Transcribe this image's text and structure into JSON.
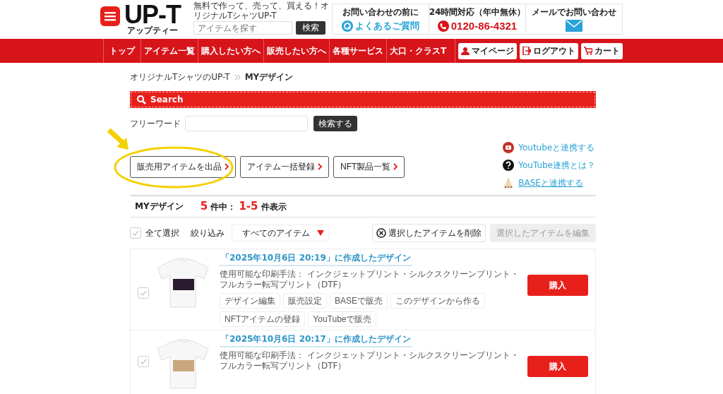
{
  "header": {
    "logo": "UP-T",
    "logo_reading": "アップティー",
    "tagline": "無料で作って、売って、買える！オリジナルTシャツUP-T",
    "search": {
      "placeholder": "アイテムを探す",
      "button": "検索"
    },
    "contacts": [
      {
        "kind": "faq",
        "caption": "お問い合わせの前に",
        "label": "よくあるご質問"
      },
      {
        "kind": "phone",
        "caption": "24時間対応（年中無休）",
        "label": "0120-86-4321"
      },
      {
        "kind": "mail",
        "caption": "メールでお問い合わせ"
      }
    ]
  },
  "nav": {
    "items": [
      "トップ",
      "アイテム一覧",
      "購入したい方へ",
      "販売したい方へ",
      "各種サービス",
      "大口・クラスT"
    ],
    "buttons": [
      {
        "kind": "user",
        "label": "マイページ"
      },
      {
        "kind": "logout",
        "label": "ログアウト"
      },
      {
        "kind": "cart",
        "label": "カート"
      }
    ]
  },
  "breadcrumb": [
    {
      "label": "オリジナルTシャツのUP-T",
      "current": false
    },
    {
      "label": "MYデザイン",
      "current": true
    }
  ],
  "search_panel": {
    "title": "Search",
    "label": "フリーワード",
    "button": "検索する"
  },
  "actions": [
    "販売用アイテムを出品",
    "アイテム一括登録",
    "NFT製品一覧"
  ],
  "side_links": [
    {
      "kind": "youtube",
      "label": "Youtubeと連携する",
      "underlined": false
    },
    {
      "kind": "help",
      "label": "YouTube連携とは？",
      "underlined": false
    },
    {
      "kind": "base",
      "label": "BASEと連携する",
      "underlined": true
    }
  ],
  "list_header": {
    "title": "MYデザイン",
    "count": "5",
    "count_suffix": "件中：",
    "range": "1-5",
    "range_suffix": "件表示"
  },
  "toolbar": {
    "select_all": {
      "label": "全て選択",
      "checked": false
    },
    "filter_label": "絞り込み",
    "filter_value": "すべてのアイテム",
    "delete": "選択したアイテムを削除",
    "edit": {
      "label": "選択したアイテムを編集",
      "disabled": true
    }
  },
  "designs": [
    {
      "checked": false,
      "title": "「2025年10月6日 20:19」に作成したデザイン",
      "methods": "使用可能な印刷手法： インクジェットプリント・シルクスクリーンプリント・フルカラー転写プリント（DTF）",
      "buy": "購入",
      "buttons": [
        "デザイン編集",
        "販売設定",
        "BASEで販売",
        "このデザインから作る",
        "NFTアイテムの登録",
        "YouTubeで販売"
      ]
    },
    {
      "checked": false,
      "title": "「2025年10月6日 20:17」に作成したデザイン",
      "methods": "使用可能な印刷手法： インクジェットプリント・シルクスクリーンプリント・フルカラー転写プリント（DTF）",
      "buy": "購入"
    }
  ]
}
